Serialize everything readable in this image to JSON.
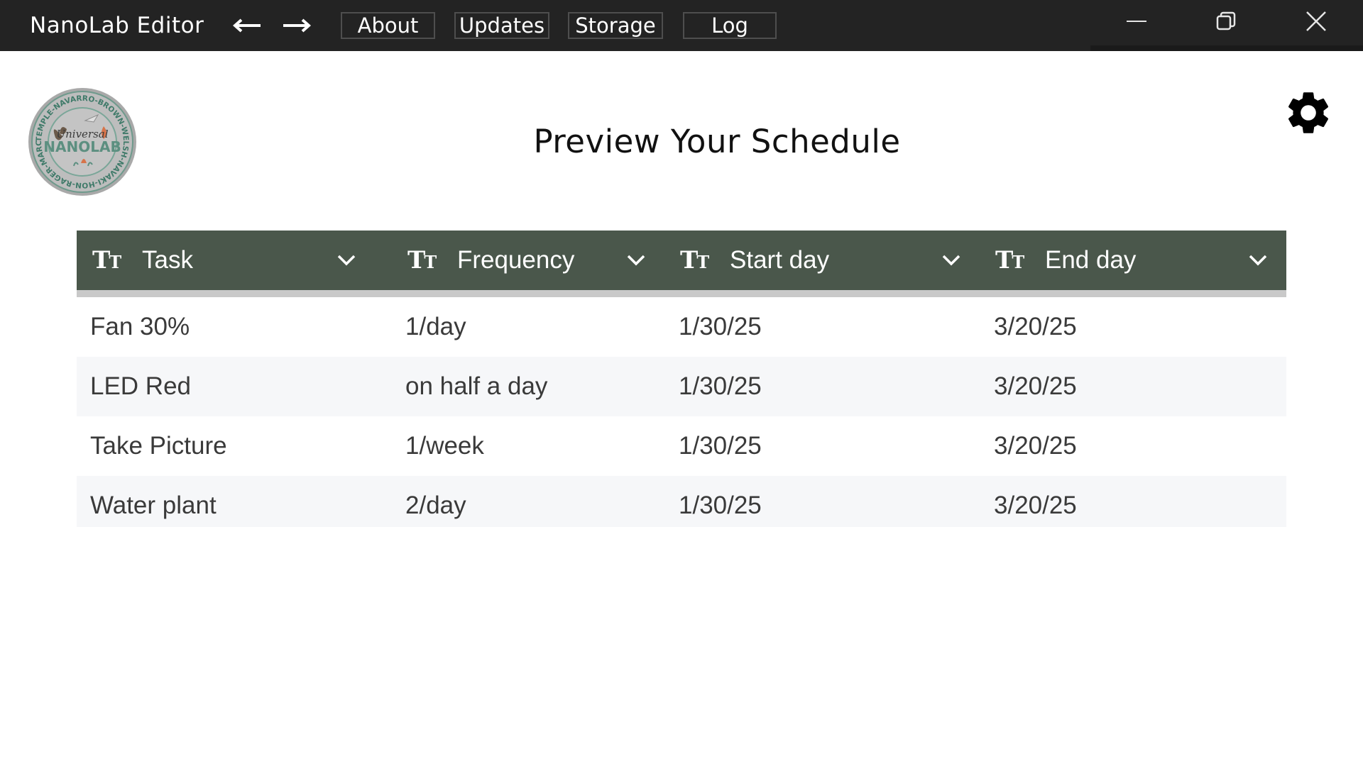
{
  "window": {
    "title": "NanoLab Editor",
    "nav": {
      "back_icon": "arrow-left-icon",
      "forward_icon": "arrow-right-icon"
    },
    "menu": [
      {
        "label": "About"
      },
      {
        "label": "Updates"
      },
      {
        "label": "Storage"
      },
      {
        "label": "Log"
      }
    ],
    "controls": [
      "minimize-icon",
      "restore-icon",
      "close-icon"
    ]
  },
  "page": {
    "title": "Preview Your Schedule",
    "logo": {
      "center_word_1": "Universal",
      "center_word_2": "NANOLAB",
      "ring_text": "TEMPLE-NAVARRO-BROWN-WELSH-NAVAKI-HON-RAGER-MARCUSON-WINKLER-POWELL"
    },
    "settings_icon": "gear-icon"
  },
  "table": {
    "columns": [
      {
        "type_icon": "text-type-icon",
        "type_glyph": "T",
        "type_glyph_small": "T",
        "label": "Task"
      },
      {
        "type_icon": "text-type-icon",
        "type_glyph": "T",
        "type_glyph_small": "T",
        "label": "Frequency"
      },
      {
        "type_icon": "text-type-icon",
        "type_glyph": "T",
        "type_glyph_small": "T",
        "label": "Start day"
      },
      {
        "type_icon": "text-type-icon",
        "type_glyph": "T",
        "type_glyph_small": "T",
        "label": "End day"
      }
    ],
    "rows": [
      {
        "task": "Fan 30%",
        "frequency": "1/day",
        "start": "1/30/25",
        "end": "3/20/25"
      },
      {
        "task": "LED Red",
        "frequency": "on half a day",
        "start": "1/30/25",
        "end": "3/20/25"
      },
      {
        "task": "Take Picture",
        "frequency": "1/week",
        "start": "1/30/25",
        "end": "3/20/25"
      },
      {
        "task": "Water plant",
        "frequency": "2/day",
        "start": "1/30/25",
        "end": "3/20/25"
      }
    ]
  },
  "colors": {
    "titlebar": "#232323",
    "table_header": "#4a574b",
    "row_alt": "#f6f7f9",
    "logo_green": "#5c8f80",
    "logo_grey": "#b9b9b9"
  }
}
